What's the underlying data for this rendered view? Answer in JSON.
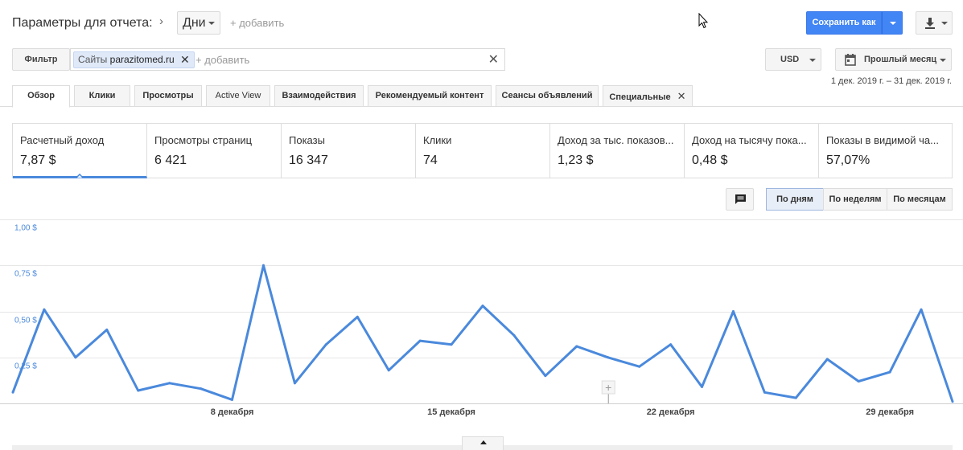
{
  "header": {
    "title": "Параметры для отчета:",
    "granularity_value": "Дни",
    "add_label": "+ добавить",
    "save_label": "Сохранить как"
  },
  "filter": {
    "button_label": "Фильтр",
    "chip_prefix": "Сайты",
    "chip_value": "parazitomed.ru",
    "chip_remove": "✕",
    "add_label": "+ добавить",
    "clear_label": "✕"
  },
  "currency": {
    "value": "USD"
  },
  "period": {
    "label": "Прошлый месяц",
    "range": "1 дек. 2019 г. – 31 дек. 2019 г."
  },
  "tabs": [
    {
      "label": "Обзор"
    },
    {
      "label": "Клики"
    },
    {
      "label": "Просмотры"
    },
    {
      "label": "Active View"
    },
    {
      "label": "Взаимодействия"
    },
    {
      "label": "Рекомендуемый контент"
    },
    {
      "label": "Сеансы объявлений"
    },
    {
      "label": "Специальные"
    }
  ],
  "tab_close": "✕",
  "metrics": [
    {
      "label": "Расчетный доход",
      "value": "7,87 $"
    },
    {
      "label": "Просмотры страниц",
      "value": "6 421"
    },
    {
      "label": "Показы",
      "value": "16 347"
    },
    {
      "label": "Клики",
      "value": "74"
    },
    {
      "label": "Доход за тыс. показов...",
      "value": "1,23 $"
    },
    {
      "label": "Доход на тысячу пока...",
      "value": "0,48 $"
    },
    {
      "label": "Показы в видимой ча...",
      "value": "57,07%"
    }
  ],
  "granularity_buttons": [
    {
      "label": "По дням",
      "active": true
    },
    {
      "label": "По неделям",
      "active": false
    },
    {
      "label": "По месяцам",
      "active": false
    }
  ],
  "colors": {
    "accent": "#4285f4",
    "series": "#4a89dc",
    "y_tick_text": "#4a89dc"
  },
  "chart_data": {
    "type": "line",
    "x": [
      "2019-12-01",
      "2019-12-02",
      "2019-12-03",
      "2019-12-04",
      "2019-12-05",
      "2019-12-06",
      "2019-12-07",
      "2019-12-08",
      "2019-12-09",
      "2019-12-10",
      "2019-12-11",
      "2019-12-12",
      "2019-12-13",
      "2019-12-14",
      "2019-12-15",
      "2019-12-16",
      "2019-12-17",
      "2019-12-18",
      "2019-12-19",
      "2019-12-20",
      "2019-12-21",
      "2019-12-22",
      "2019-12-23",
      "2019-12-24",
      "2019-12-25",
      "2019-12-26",
      "2019-12-27",
      "2019-12-28",
      "2019-12-29",
      "2019-12-30",
      "2019-12-31"
    ],
    "series": [
      {
        "values": [
          0.06,
          0.51,
          0.25,
          0.4,
          0.07,
          0.11,
          0.08,
          0.02,
          0.75,
          0.11,
          0.32,
          0.47,
          0.18,
          0.34,
          0.32,
          0.53,
          0.37,
          0.15,
          0.31,
          0.25,
          0.2,
          0.32,
          0.09,
          0.5,
          0.06,
          0.03,
          0.24,
          0.12,
          0.17,
          0.51,
          0.01
        ]
      }
    ],
    "ylim": [
      0,
      1.0
    ],
    "y_ticks": [
      0.25,
      0.5,
      0.75,
      1.0
    ],
    "y_tick_labels": [
      "0,25 $",
      "0,50 $",
      "0,75 $",
      "1,00 $"
    ],
    "x_tick_labels": [
      {
        "date": "2019-12-08",
        "label": "8 декабря"
      },
      {
        "date": "2019-12-15",
        "label": "15 декабря"
      },
      {
        "date": "2019-12-22",
        "label": "22 декабря"
      },
      {
        "date": "2019-12-29",
        "label": "29 декабря"
      }
    ],
    "annotation_marker_date": "2019-12-20",
    "grid": true
  }
}
